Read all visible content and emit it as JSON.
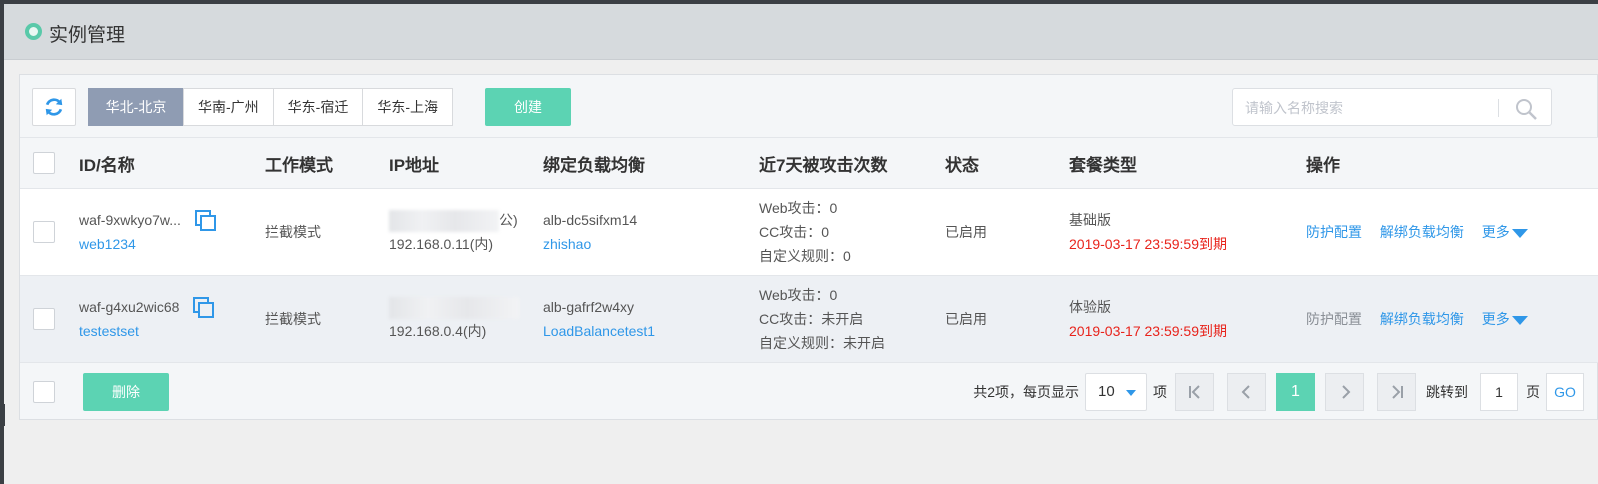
{
  "header": {
    "title": "实例管理"
  },
  "toolbar": {
    "regions": [
      "华北-北京",
      "华南-广州",
      "华东-宿迁",
      "华东-上海"
    ],
    "create_label": "创建",
    "search_placeholder": "请输入名称搜索"
  },
  "table": {
    "headers": [
      "ID/名称",
      "工作模式",
      "IP地址",
      "绑定负载均衡",
      "近7天被攻击次数",
      "状态",
      "套餐类型",
      "操作"
    ],
    "rows": [
      {
        "id": "waf-9xwkyo7w...",
        "name": "web1234",
        "mode": "拦截模式",
        "ip_public_suffix": "公)",
        "ip_private": "192.168.0.11(内)",
        "lb_id": "alb-dc5sifxm14",
        "lb_name": "zhishao",
        "attack_web": "Web攻击：0",
        "attack_cc": "CC攻击：0",
        "attack_custom": "自定义规则：0",
        "status": "已启用",
        "plan": "基础版",
        "expire": "2019-03-17 23:59:59到期",
        "op_protect": "防护配置",
        "op_unbind": "解绑负载均衡",
        "op_more": "更多"
      },
      {
        "id": "waf-g4xu2wic68",
        "name": "testestset",
        "mode": "拦截模式",
        "ip_public_suffix": "",
        "ip_private": "192.168.0.4(内)",
        "lb_id": "alb-gafrf2w4xy",
        "lb_name": "LoadBalancetest1",
        "attack_web": "Web攻击：0",
        "attack_cc": "CC攻击：未开启",
        "attack_custom": "自定义规则：未开启",
        "status": "已启用",
        "plan": "体验版",
        "expire": "2019-03-17 23:59:59到期",
        "op_protect": "防护配置",
        "op_unbind": "解绑负载均衡",
        "op_more": "更多"
      }
    ]
  },
  "footer": {
    "delete_label": "删除",
    "total_text": "共2项，每页显示",
    "page_size": "10",
    "item_unit": "项",
    "current_page": "1",
    "jump_label": "跳转到",
    "jump_value": "1",
    "page_unit": "页",
    "go_label": "GO"
  },
  "colors": {
    "accent": "#5cd3b3",
    "link": "#2f97e8",
    "active_region": "#8f9cb3",
    "expire": "#e8231b",
    "enabled": "#37c195"
  }
}
